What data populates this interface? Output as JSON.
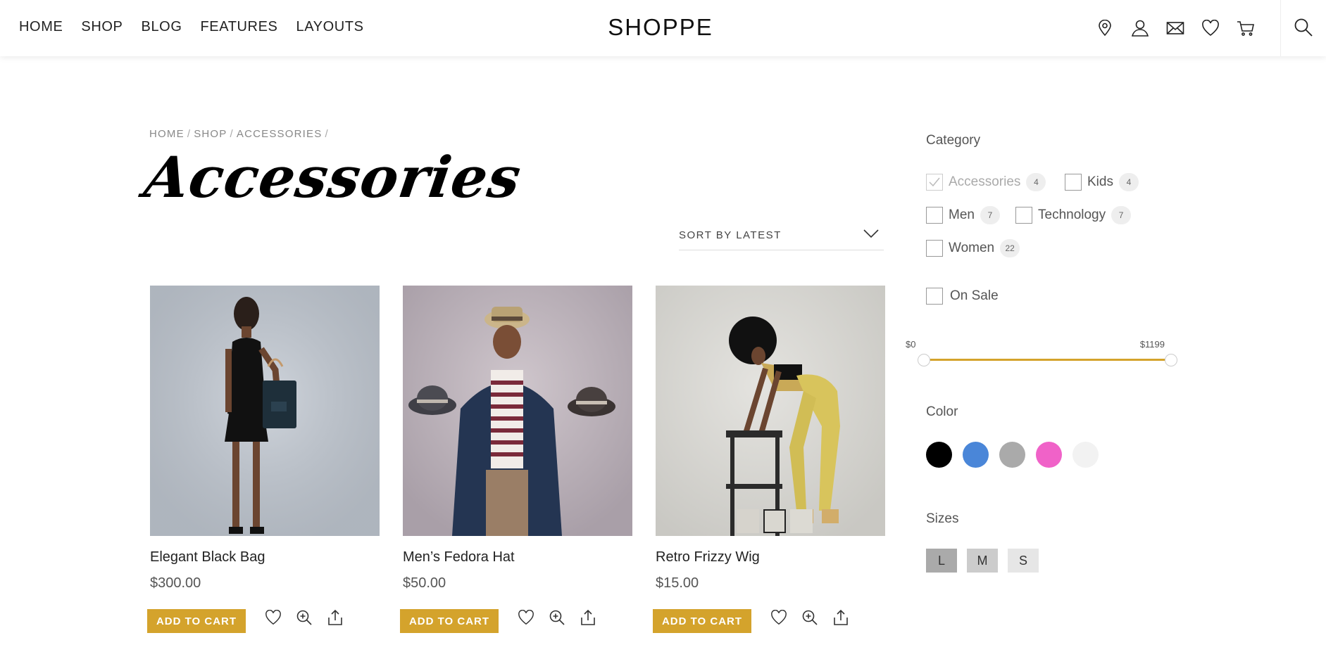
{
  "header": {
    "nav": [
      "HOME",
      "SHOP",
      "BLOG",
      "FEATURES",
      "LAYOUTS"
    ],
    "logo": "SHOPPE",
    "icons": [
      "location-icon",
      "user-icon",
      "mail-icon",
      "heart-icon",
      "cart-icon",
      "search-icon"
    ]
  },
  "breadcrumb": [
    "HOME",
    "SHOP",
    "ACCESSORIES"
  ],
  "page_title": "Accessories",
  "sort": {
    "label": "SORT BY LATEST"
  },
  "products": [
    {
      "name": "Elegant Black Bag",
      "price": "$300.00",
      "add_to_cart": "ADD TO CART"
    },
    {
      "name": "Men’s Fedora Hat",
      "price": "$50.00",
      "add_to_cart": "ADD TO CART"
    },
    {
      "name": "Retro Frizzy Wig",
      "price": "$15.00",
      "add_to_cart": "ADD TO CART"
    }
  ],
  "sidebar": {
    "category_heading": "Category",
    "categories": [
      {
        "label": "Accessories",
        "count": "4",
        "checked": true
      },
      {
        "label": "Kids",
        "count": "4",
        "checked": false
      },
      {
        "label": "Men",
        "count": "7",
        "checked": false
      },
      {
        "label": "Technology",
        "count": "7",
        "checked": false
      },
      {
        "label": "Women",
        "count": "22",
        "checked": false
      }
    ],
    "on_sale": "On Sale",
    "price_min": "$0",
    "price_max": "$1199",
    "color_heading": "Color",
    "colors": [
      "#000000",
      "#4a86d8",
      "#aaaaaa",
      "#f062c8",
      "#f2f2f2"
    ],
    "sizes_heading": "Sizes",
    "sizes": [
      {
        "label": "L",
        "bg": "#aaaaaa"
      },
      {
        "label": "M",
        "bg": "#cccccc"
      },
      {
        "label": "S",
        "bg": "#e6e6e6"
      }
    ]
  },
  "colors": {
    "accent": "#d4a32c"
  }
}
